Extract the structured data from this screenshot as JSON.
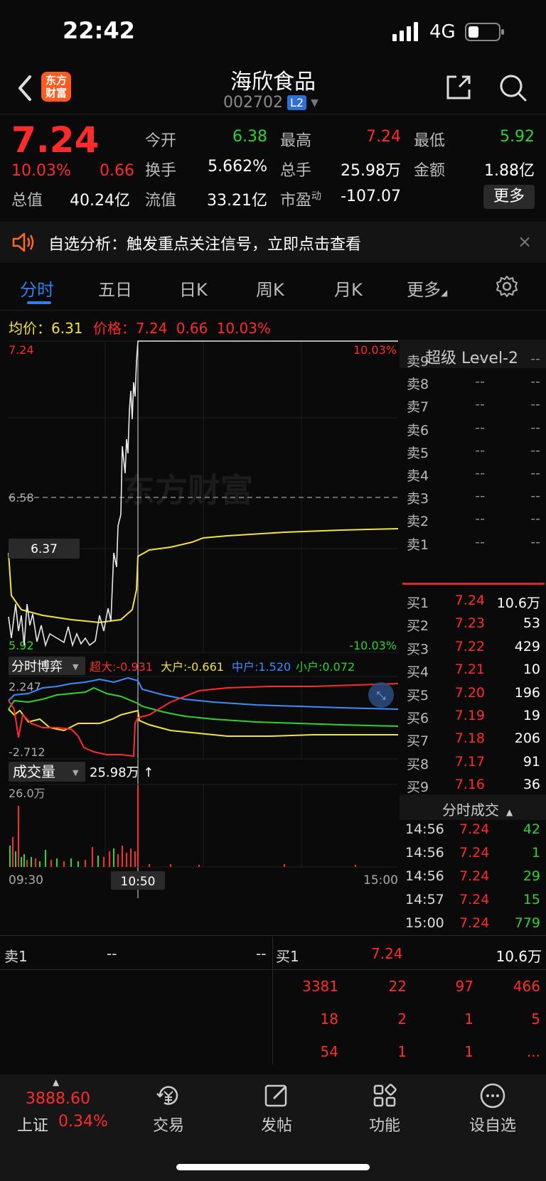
{
  "status": {
    "time": "22:42",
    "network": "4G"
  },
  "header": {
    "logo_text": "东方财富",
    "name": "海欣食品",
    "code": "002702",
    "badge": "L2"
  },
  "quote": {
    "price": "7.24",
    "pct": "10.03%",
    "change": "0.66",
    "total_mv_label": "总值",
    "total_mv": "40.24亿",
    "open_label": "今开",
    "open": "6.38",
    "high_label": "最高",
    "high": "7.24",
    "low_label": "最低",
    "low": "5.92",
    "turnover_label": "换手",
    "turnover": "5.662%",
    "volume_label": "总手",
    "volume": "25.98万",
    "amount_label": "金额",
    "amount": "1.88亿",
    "float_label": "流值",
    "float_mv": "33.21亿",
    "pe_label": "市盈",
    "pe_sup": "动",
    "pe": "-107.07",
    "more": "更多"
  },
  "notice": {
    "text": "自选分析：触发重点关注信号，立即点击查看",
    "close": "×"
  },
  "tabs": [
    "分时",
    "五日",
    "日K",
    "周K",
    "月K",
    "更多"
  ],
  "avg_row": {
    "avg_label": "均价：",
    "avg": "6.31",
    "price_label": "价格：",
    "price": "7.24",
    "chg": "0.66",
    "pct": "10.03%"
  },
  "chart": {
    "top_price": "7.24",
    "top_pct": "10.03%",
    "mid_price": "6.58",
    "bottom_price": "5.92",
    "bottom_pct": "-10.03%",
    "cursor_label": "6.37",
    "game_label": "分时博弈",
    "game_super": "超大:-0.931",
    "game_big": "大户:-0.661",
    "game_mid": "中户:1.520",
    "game_small": "小户:0.072",
    "game_max": "2.247",
    "game_min": "-2.712",
    "vol_label": "成交量",
    "vol_total": "25.98万 ↑",
    "vol_max": "26.0万",
    "time_start": "09:30",
    "time_cursor": "10:50",
    "time_end": "15:00",
    "watermark": "东方财富"
  },
  "level2": {
    "title": "超级 Level-2",
    "asks": [
      {
        "name": "卖9",
        "price": "--",
        "vol": "--"
      },
      {
        "name": "卖8",
        "price": "--",
        "vol": "--"
      },
      {
        "name": "卖7",
        "price": "--",
        "vol": "--"
      },
      {
        "name": "卖6",
        "price": "--",
        "vol": "--"
      },
      {
        "name": "卖5",
        "price": "--",
        "vol": "--"
      },
      {
        "name": "卖4",
        "price": "--",
        "vol": "--"
      },
      {
        "name": "卖3",
        "price": "--",
        "vol": "--"
      },
      {
        "name": "卖2",
        "price": "--",
        "vol": "--"
      },
      {
        "name": "卖1",
        "price": "--",
        "vol": "--"
      }
    ],
    "bids": [
      {
        "name": "买1",
        "price": "7.24",
        "vol": "10.6万"
      },
      {
        "name": "买2",
        "price": "7.23",
        "vol": "53"
      },
      {
        "name": "买3",
        "price": "7.22",
        "vol": "429"
      },
      {
        "name": "买4",
        "price": "7.21",
        "vol": "10"
      },
      {
        "name": "买5",
        "price": "7.20",
        "vol": "196"
      },
      {
        "name": "买6",
        "price": "7.19",
        "vol": "19"
      },
      {
        "name": "买7",
        "price": "7.18",
        "vol": "206"
      },
      {
        "name": "买8",
        "price": "7.17",
        "vol": "91"
      },
      {
        "name": "买9",
        "price": "7.16",
        "vol": "36"
      }
    ],
    "ticks_title": "分时成交",
    "ticks": [
      {
        "time": "14:56",
        "price": "7.24",
        "vol": "42"
      },
      {
        "time": "14:56",
        "price": "7.24",
        "vol": "1"
      },
      {
        "time": "14:56",
        "price": "7.24",
        "vol": "29"
      },
      {
        "time": "14:57",
        "price": "7.24",
        "vol": "15"
      },
      {
        "time": "15:00",
        "price": "7.24",
        "vol": "779"
      }
    ]
  },
  "bottom_table": {
    "sell_label": "卖1",
    "sell_price": "--",
    "sell_vol": "--",
    "buy_label": "买1",
    "buy_price": "7.24",
    "buy_vol": "10.6万",
    "rows": [
      [
        "3381",
        "22",
        "97",
        "466"
      ],
      [
        "18",
        "2",
        "1",
        "5"
      ],
      [
        "54",
        "1",
        "1",
        "..."
      ]
    ]
  },
  "bottom_nav": {
    "index_value": "3888.60",
    "index_name": "上证",
    "index_pct": "0.34%",
    "items": [
      "交易",
      "发帖",
      "功能",
      "设自选"
    ]
  },
  "colors": {
    "up": "#ff2b2b",
    "down": "#2ed32e",
    "avg": "#f2e23a",
    "accent": "#2f80ed"
  }
}
